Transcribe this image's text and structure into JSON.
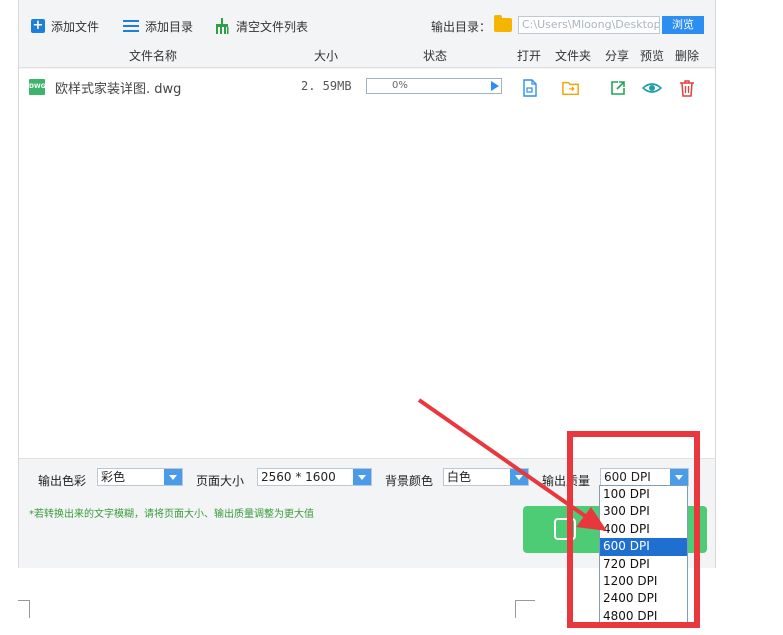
{
  "toolbar": {
    "add_file": "添加文件",
    "add_dir": "添加目录",
    "clear_list": "清空文件列表",
    "output_dir_label": "输出目录：",
    "output_path": "C:\\Users\\Mloong\\Desktop",
    "browse": "浏览"
  },
  "table": {
    "headers": {
      "name": "文件名称",
      "size": "大小",
      "status": "状态",
      "open": "打开",
      "folder": "文件夹",
      "share": "分享",
      "preview": "预览",
      "delete": "删除"
    },
    "rows": [
      {
        "icon_text": "DWG",
        "name": "欧样式家装详图. dwg",
        "size": "2. 59MB",
        "progress_text": "0%",
        "progress": 0.0
      }
    ]
  },
  "options": {
    "color_label": "输出色彩",
    "color_value": "彩色",
    "page_size_label": "页面大小",
    "page_size_value": "2560 * 1600",
    "bg_label": "背景颜色",
    "bg_value": "白色",
    "quality_label": "输出质量",
    "quality_value": "600 DPI"
  },
  "hint": "*若转换出来的文字模糊，请将页面大小、输出质量调整为更大值",
  "quality_options": [
    "100 DPI",
    "300 DPI",
    "400 DPI",
    "600 DPI",
    "720 DPI",
    "1200 DPI",
    "2400 DPI",
    "4800 DPI"
  ],
  "quality_selected_index": 3,
  "colors": {
    "accent_blue": "#2c8ef0",
    "convert_green": "#4ecb75",
    "annotation_red": "#e8383d",
    "hint_green": "#3a9b3a"
  },
  "icons": {
    "add_file": "plus-icon",
    "add_dir": "list-icon",
    "clear": "broom-icon",
    "output_folder": "folder-icon",
    "open": "document-icon",
    "open_folder": "folder-icon",
    "share": "share-icon",
    "preview": "eye-icon",
    "delete": "trash-icon"
  }
}
